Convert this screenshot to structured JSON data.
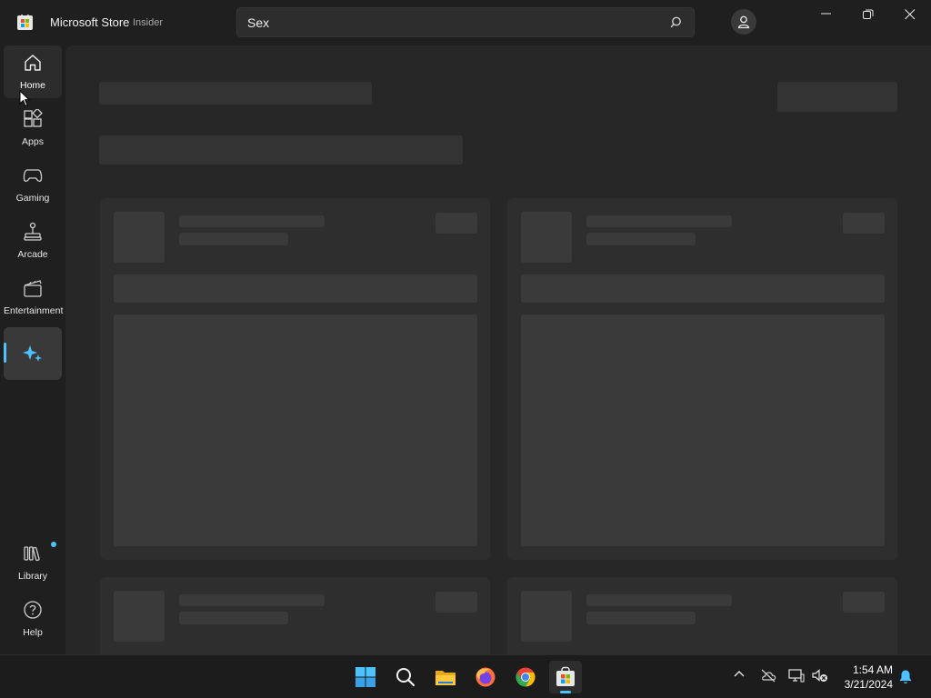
{
  "titlebar": {
    "app_title": "Microsoft Store",
    "app_badge": "Insider",
    "search_value": "Sex"
  },
  "sidebar": {
    "items": [
      {
        "label": "Home",
        "icon": "home-icon"
      },
      {
        "label": "Apps",
        "icon": "apps-icon"
      },
      {
        "label": "Gaming",
        "icon": "gaming-icon"
      },
      {
        "label": "Arcade",
        "icon": "arcade-icon"
      },
      {
        "label": "Entertainment",
        "icon": "entertainment-icon"
      },
      {
        "label": "",
        "icon": "sparkle-icon"
      }
    ],
    "bottom_items": [
      {
        "label": "Library",
        "icon": "library-icon"
      },
      {
        "label": "Help",
        "icon": "help-icon"
      }
    ]
  },
  "taskbar": {
    "time": "1:54 AM",
    "date": "3/21/2024"
  },
  "colors": {
    "accent": "#4cc2ff",
    "background": "#1f1f1f",
    "main": "#272727"
  }
}
